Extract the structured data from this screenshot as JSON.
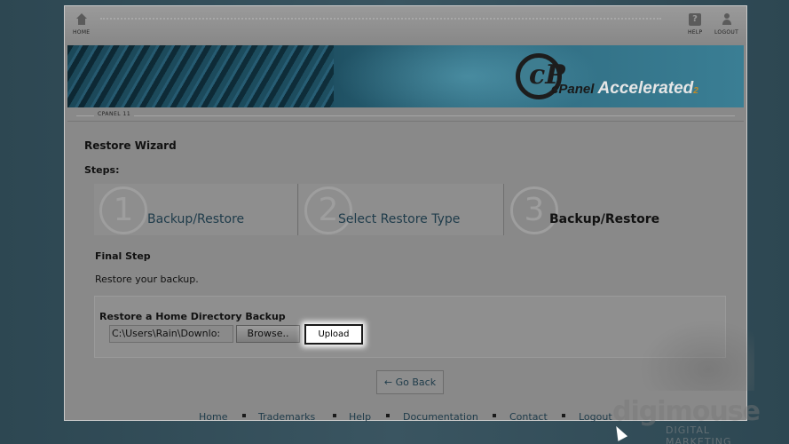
{
  "topbar": {
    "home_label": "HOME",
    "help_label": "HELP",
    "logout_label": "LOGOUT"
  },
  "banner": {
    "brand": "cPanel",
    "product": "Accelerated",
    "version": "2"
  },
  "crumb": "CPANEL 11",
  "page": {
    "title": "Restore Wizard",
    "steps_label": "Steps:"
  },
  "steps": [
    {
      "num": "1",
      "label": "Backup/Restore"
    },
    {
      "num": "2",
      "label": "Select Restore Type"
    },
    {
      "num": "3",
      "label": "Backup/Restore"
    }
  ],
  "final": {
    "title": "Final Step",
    "note": "Restore your backup."
  },
  "restore_panel": {
    "title": "Restore a Home Directory Backup",
    "file_value": "C:\\Users\\Rain\\Downlo:",
    "browse_label": "Browse..",
    "upload_label": "Upload"
  },
  "go_back_label": "← Go Back",
  "footer": {
    "links": [
      "Home",
      "Trademarks",
      "Help",
      "Documentation",
      "Contact",
      "Logout"
    ]
  },
  "watermark": {
    "name": "digimouse",
    "tagline": "DIGITAL MARKETING"
  },
  "colors": {
    "background": "#314a56",
    "frame": "#898989",
    "link": "#1e3b4a",
    "upload_bg": "#ffffff"
  }
}
